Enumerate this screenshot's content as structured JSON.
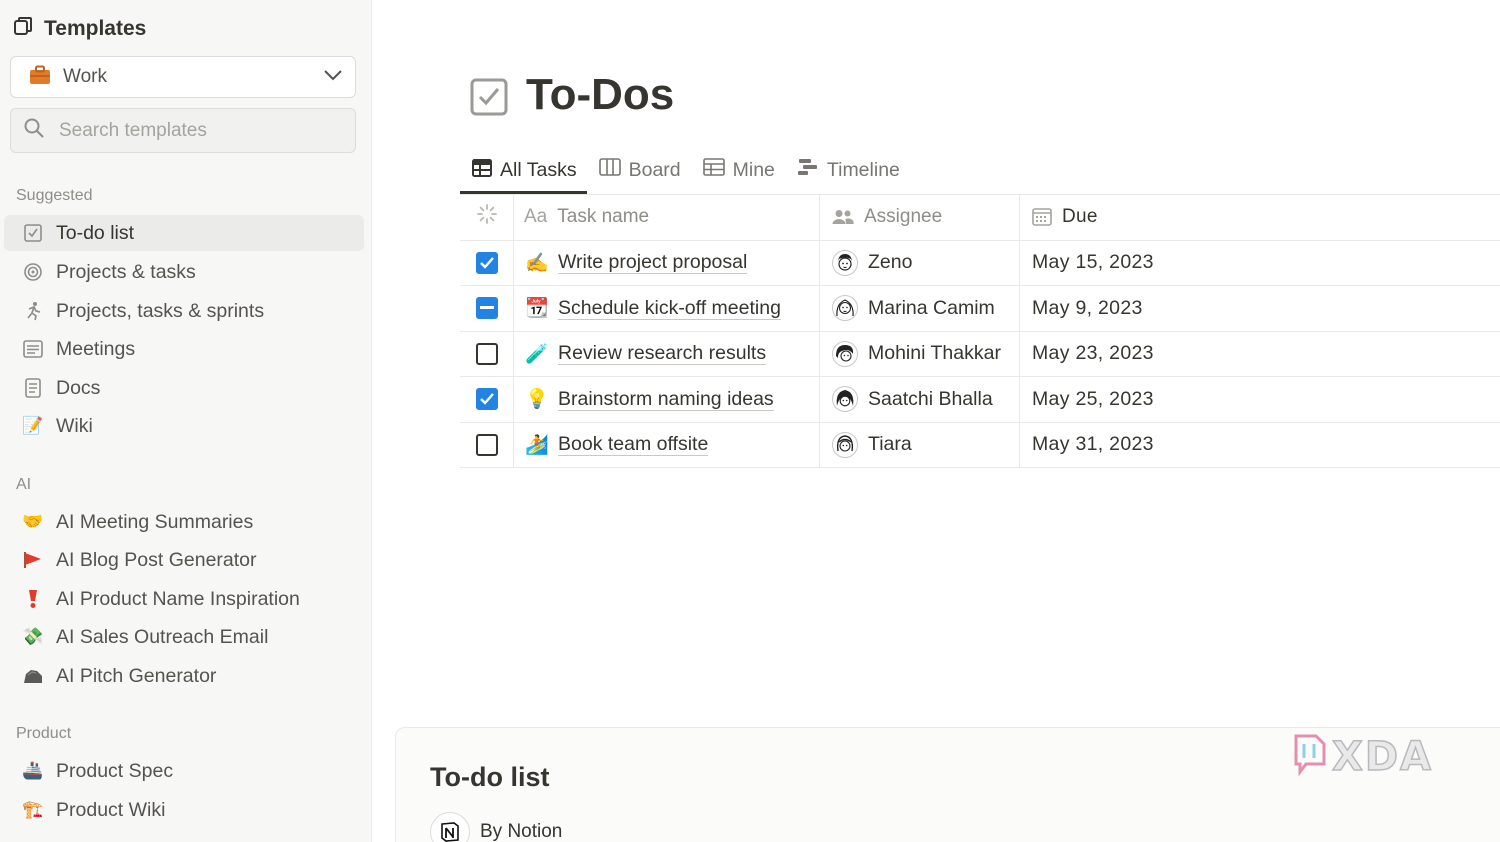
{
  "sidebar": {
    "title": "Templates",
    "category": {
      "selected": "Work"
    },
    "search": {
      "placeholder": "Search templates"
    },
    "sections": {
      "suggested": "Suggested",
      "ai": "AI",
      "product": "Product"
    },
    "suggested_items": [
      {
        "label": "To-do list",
        "icon": "checkbox-icon"
      },
      {
        "label": "Projects & tasks",
        "icon": "target-icon"
      },
      {
        "label": "Projects, tasks & sprints",
        "icon": "runner-icon"
      },
      {
        "label": "Meetings",
        "icon": "list-doc-icon"
      },
      {
        "label": "Docs",
        "icon": "document-icon"
      },
      {
        "label": "Wiki",
        "icon": "memo-emoji"
      }
    ],
    "ai_items": [
      {
        "label": "AI Meeting Summaries",
        "icon": "handshake-emoji"
      },
      {
        "label": "AI Blog Post Generator",
        "icon": "flag-emoji"
      },
      {
        "label": "AI Product Name Inspiration",
        "icon": "exclamation-emoji"
      },
      {
        "label": "AI Sales Outreach Email",
        "icon": "money-wings-emoji"
      },
      {
        "label": "AI Pitch Generator",
        "icon": "rock-emoji"
      }
    ],
    "product_items": [
      {
        "label": "Product Spec",
        "icon": "ship-emoji"
      },
      {
        "label": "Product Wiki",
        "icon": "crane-emoji"
      }
    ]
  },
  "main": {
    "title": "To-Dos",
    "tabs": [
      {
        "label": "All Tasks",
        "icon": "table-icon"
      },
      {
        "label": "Board",
        "icon": "board-icon"
      },
      {
        "label": "Mine",
        "icon": "table-icon"
      },
      {
        "label": "Timeline",
        "icon": "timeline-icon"
      }
    ],
    "columns": {
      "name": "Task name",
      "name_prefix": "Aa",
      "assignee": "Assignee",
      "due": "Due"
    },
    "rows": [
      {
        "done": "checked",
        "emoji": "✍️",
        "name": "Write project proposal",
        "assignee": "Zeno",
        "due": "May 15, 2023"
      },
      {
        "done": "partial",
        "emoji": "📆",
        "name": "Schedule kick-off meeting",
        "assignee": "Marina Camim",
        "due": "May 9, 2023"
      },
      {
        "done": "unchecked",
        "emoji": "🧪",
        "name": "Review research results",
        "assignee": "Mohini Thakkar",
        "due": "May 23, 2023"
      },
      {
        "done": "checked",
        "emoji": "💡",
        "name": "Brainstorm naming ideas",
        "assignee": "Saatchi Bhalla",
        "due": "May 25, 2023"
      },
      {
        "done": "unchecked",
        "emoji": "🏄",
        "name": "Book team offsite",
        "assignee": "Tiara",
        "due": "May 31, 2023"
      }
    ]
  },
  "preview": {
    "title": "To-do list",
    "author": "By Notion"
  },
  "watermark": "XDA",
  "colors": {
    "accent": "#2383e2",
    "sidebar_bg": "#f7f7f5",
    "text": "#37352f",
    "muted": "#8f8d88",
    "briefcase": "#e07b2a"
  }
}
